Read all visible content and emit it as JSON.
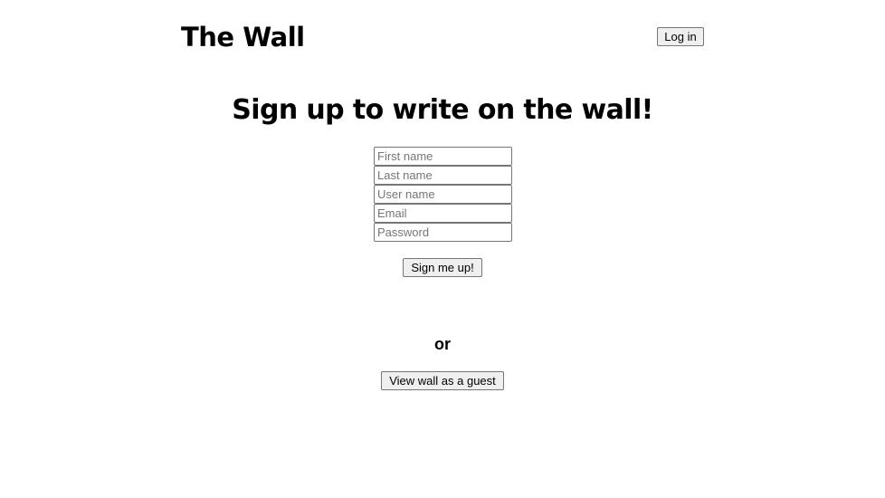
{
  "header": {
    "title": "The Wall",
    "login_label": "Log in"
  },
  "main": {
    "headline": "Sign up to write on the wall!",
    "form": {
      "first_name_placeholder": "First name",
      "last_name_placeholder": "Last name",
      "user_name_placeholder": "User name",
      "email_placeholder": "Email",
      "password_placeholder": "Password",
      "submit_label": "Sign me up!"
    },
    "divider_text": "or",
    "guest_label": "View wall as a guest"
  }
}
